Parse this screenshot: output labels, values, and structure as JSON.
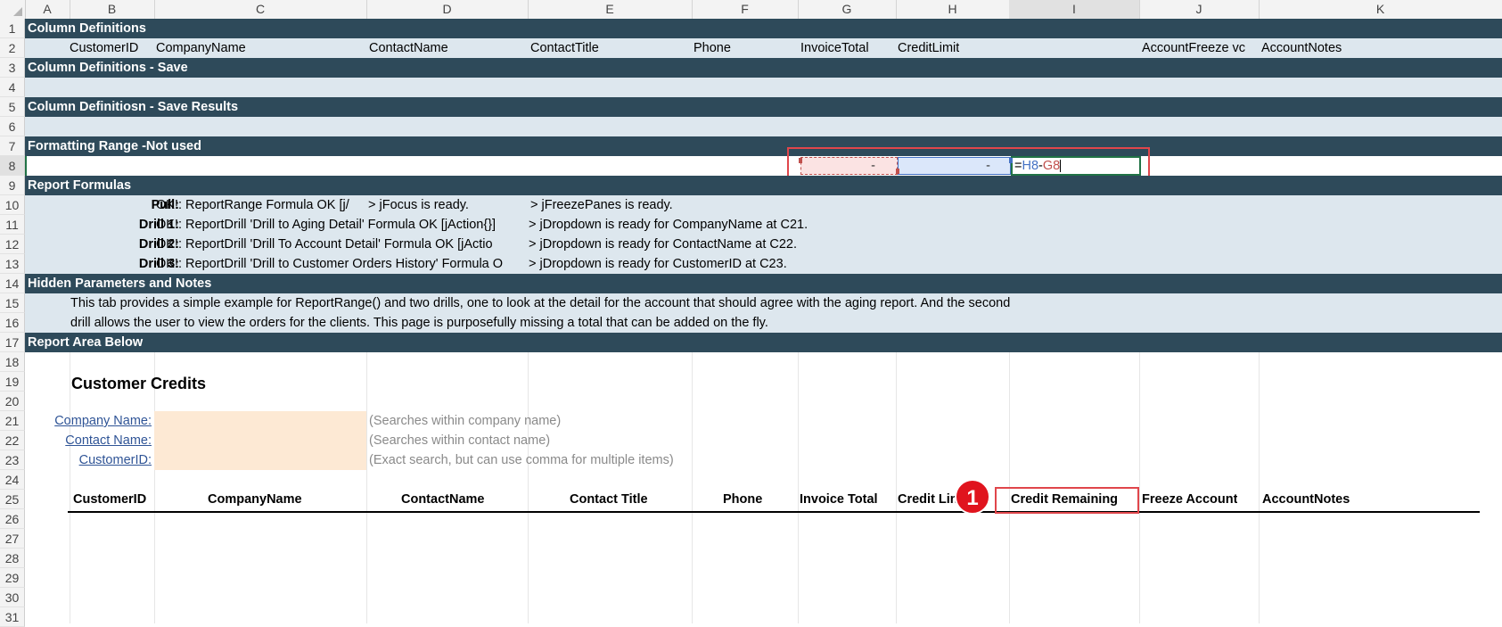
{
  "columns": [
    "A",
    "B",
    "C",
    "D",
    "E",
    "F",
    "G",
    "H",
    "I",
    "J",
    "K"
  ],
  "rows": [
    "1",
    "2",
    "3",
    "4",
    "5",
    "6",
    "7",
    "8",
    "9",
    "10",
    "11",
    "12",
    "13",
    "14",
    "15",
    "16",
    "17",
    "18",
    "19",
    "20",
    "21",
    "22",
    "23",
    "24",
    "25",
    "26",
    "27",
    "28",
    "29",
    "30",
    "31"
  ],
  "sections": {
    "r1": "Column Definitions",
    "r3": "Column Definitions - Save",
    "r5": "Column Definitiosn - Save Results",
    "r7": "Formatting Range -Not used",
    "r9": "Report Formulas",
    "r14": "Hidden Parameters and Notes",
    "r17": "Report Area Below"
  },
  "col_defs": {
    "customer_id": "CustomerID",
    "company_name": "CompanyName",
    "contact_name": "ContactName",
    "contact_title": "ContactTitle",
    "phone": "Phone",
    "invoice_total": "InvoiceTotal",
    "credit_limit": "CreditLimit",
    "account_freeze": "AccountFreeze vc",
    "account_notes": "AccountNotes"
  },
  "formatting_row": {
    "g8": "-",
    "h8": "-",
    "formula_eq": "=",
    "formula_ref1": "H8",
    "formula_minus": "-",
    "formula_ref2": "G8"
  },
  "report_formulas": [
    {
      "label": "Pull:",
      "text": "OK!: ReportRange Formula OK [j/",
      "text2": "> jFocus is ready.",
      "text3": "> jFreezePanes is ready."
    },
    {
      "label": "Drill 1:",
      "text": "OK!: ReportDrill 'Drill to Aging Detail' Formula OK [jAction{}]",
      "text2": "> jDropdown is ready for CompanyName at C21.",
      "text3": ""
    },
    {
      "label": "Drill 2:",
      "text": "OK!: ReportDrill 'Drill To Account Detail' Formula OK [jActio",
      "text2": "> jDropdown is ready for ContactName at C22.",
      "text3": ""
    },
    {
      "label": "Drill 3:",
      "text": "OK!: ReportDrill 'Drill to Customer Orders History' Formula O",
      "text2": "> jDropdown is ready for CustomerID at C23.",
      "text3": ""
    }
  ],
  "notes": {
    "line1": "This tab provides a simple example for ReportRange() and two drills, one to look at the detail for the account that should agree with the aging report. And the second",
    "line2": "drill allows the user to view the orders for the clients.   This page is purposefully missing a total that can be added on the fly."
  },
  "report": {
    "title": "Customer Credits",
    "filters": [
      {
        "label": "Company Name:",
        "hint": "(Searches within company name)"
      },
      {
        "label": "Contact Name:",
        "hint": "(Searches within contact name)"
      },
      {
        "label": "CustomerID:",
        "hint": "(Exact search, but can use comma for multiple items)"
      }
    ],
    "headers": {
      "customer_id": "CustomerID",
      "company_name": "CompanyName",
      "contact_name": "ContactName",
      "contact_title": "Contact Title",
      "phone": "Phone",
      "invoice_total": "Invoice Total",
      "credit_limit": "Credit Lin",
      "credit_remaining": "Credit Remaining",
      "freeze_account": "Freeze Account",
      "account_notes": "AccountNotes"
    }
  },
  "callout": {
    "number": "1"
  },
  "colors": {
    "dark_band": "#2e4a5a",
    "light_band": "#dde7ee",
    "tan_input": "#fde9d4",
    "highlight_red": "#e0464b",
    "badge_red": "#e0141e"
  }
}
